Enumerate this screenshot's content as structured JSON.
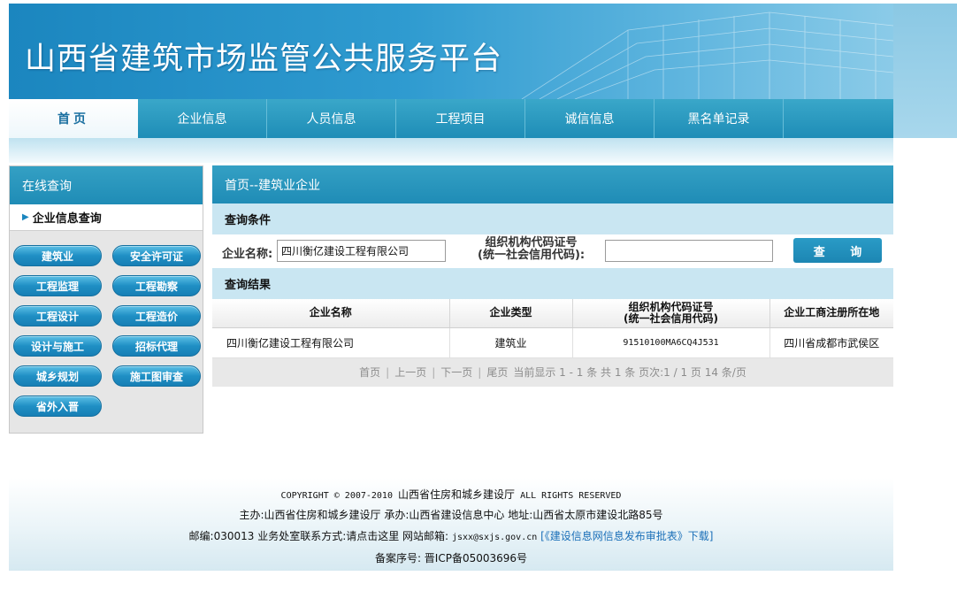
{
  "header": {
    "site_title": "山西省建筑市场监管公共服务平台"
  },
  "nav": {
    "items": [
      "首页",
      "企业信息",
      "人员信息",
      "工程项目",
      "诚信信息",
      "黑名单记录"
    ]
  },
  "sidebar": {
    "title": "在线查询",
    "subtitle": "企业信息查询",
    "buttons": [
      "建筑业",
      "安全许可证",
      "工程监理",
      "工程勘察",
      "工程设计",
      "工程造价",
      "设计与施工",
      "招标代理",
      "城乡规划",
      "施工图审查",
      "省外入晋"
    ]
  },
  "main": {
    "breadcrumb": "首页--建筑业企业",
    "query_section": "查询条件",
    "name_label": "企业名称:",
    "name_value": "四川衡亿建设工程有限公司",
    "code_label_1": "组织机构代码证号",
    "code_label_2": "(统一社会信用代码):",
    "code_value": "",
    "query_button": "查 询",
    "results_section": "查询结果",
    "table": {
      "headers": [
        "企业名称",
        "企业类型",
        "组织机构代码证号",
        "(统一社会信用代码)",
        "企业工商注册所在地"
      ],
      "rows": [
        [
          "四川衡亿建设工程有限公司",
          "建筑业",
          "91510100MA6CQ4J531",
          "四川省成都市武侯区"
        ]
      ]
    },
    "pager": {
      "first": "首页",
      "prev": "上一页",
      "next": "下一页",
      "last": "尾页",
      "status": "当前显示 1 - 1 条 共 1 条 页次:1 / 1 页 14 条/页"
    }
  },
  "footer": {
    "copyright_prefix": "COPYRIGHT © 2007-2010",
    "copyright_org": "山西省住房和城乡建设厅",
    "copyright_suffix": "ALL RIGHTS RESERVED",
    "line2": "主办:山西省住房和城乡建设厅 承办:山西省建设信息中心 地址:山西省太原市建设北路85号",
    "line3_prefix": "邮编:030013 业务处室联系方式:请点击这里 网站邮箱:",
    "email": "jsxx@sxjs.gov.cn",
    "download_link": "[《建设信息网信息发布审批表》下载]",
    "icp": "备案序号: 晋ICP备05003696号"
  }
}
